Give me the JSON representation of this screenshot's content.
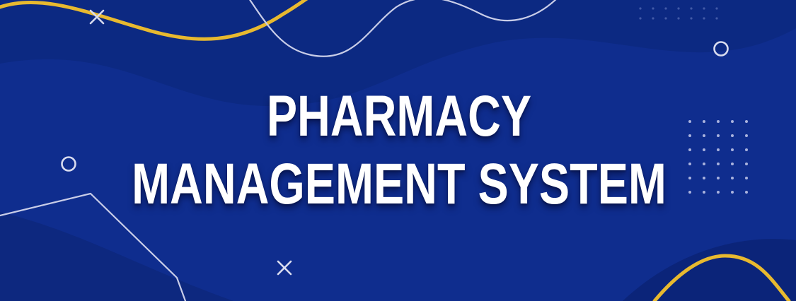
{
  "banner": {
    "title_line_1": "PHARMACY",
    "title_line_2": "MANAGEMENT SYSTEM"
  },
  "colors": {
    "background": "#0f2d8e",
    "background_dark": "#0a2375",
    "accent_gold": "#e8b92f",
    "line_light": "#c9cde8",
    "text": "#ffffff"
  },
  "icons": [
    "cross-icon",
    "ring-icon",
    "dot-grid-icon"
  ]
}
